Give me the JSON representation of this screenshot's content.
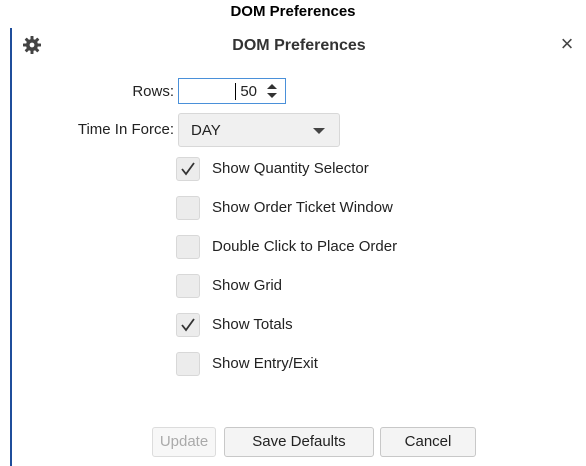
{
  "caption": "DOM Preferences",
  "dialog": {
    "title": "DOM Preferences",
    "close_glyph": "×",
    "icons": {
      "settings": "gear-icon",
      "close": "close-icon"
    }
  },
  "fields": {
    "rows_label": "Rows:",
    "rows_value": "50",
    "tif_label": "Time In Force:",
    "tif_value": "DAY"
  },
  "checkboxes": [
    {
      "label": "Show Quantity Selector",
      "checked": true
    },
    {
      "label": "Show Order Ticket Window",
      "checked": false
    },
    {
      "label": "Double Click to Place Order",
      "checked": false
    },
    {
      "label": "Show Grid",
      "checked": false
    },
    {
      "label": "Show Totals",
      "checked": true
    },
    {
      "label": "Show Entry/Exit",
      "checked": false
    }
  ],
  "buttons": {
    "update": "Update",
    "save_defaults": "Save Defaults",
    "cancel": "Cancel"
  },
  "colors": {
    "accent_border": "#1f4e9b",
    "input_focus": "#4a90d9"
  }
}
